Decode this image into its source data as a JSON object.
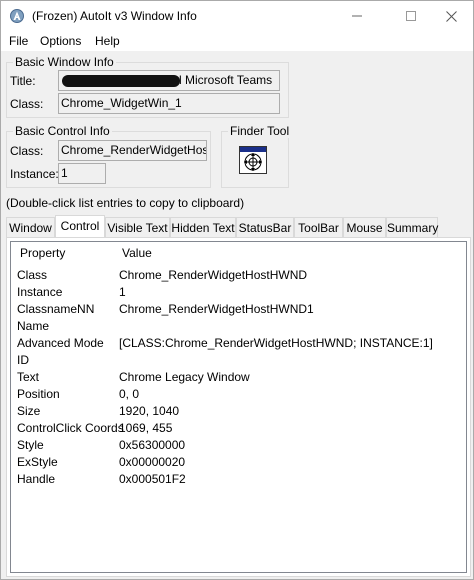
{
  "window": {
    "title": "(Frozen) AutoIt v3 Window Info",
    "minimize_glyph": "—",
    "maximize_glyph": "☐",
    "close_glyph": "✕"
  },
  "menu": {
    "file": "File",
    "options": "Options",
    "help": "Help"
  },
  "basic_window_info": {
    "label": "Basic Window Info",
    "title_label": "Title:",
    "title_value": "l Microsoft Teams",
    "class_label": "Class:",
    "class_value": "Chrome_WidgetWin_1"
  },
  "basic_control_info": {
    "label": "Basic Control Info",
    "class_label": "Class:",
    "class_value": "Chrome_RenderWidgetHostH\\",
    "instance_label": "Instance:",
    "instance_value": "1"
  },
  "finder_tool": {
    "label": "Finder Tool",
    "icon": "crosshair-icon"
  },
  "hint": "(Double-click list entries to copy to clipboard)",
  "tabs": [
    {
      "label": "Window"
    },
    {
      "label": "Control"
    },
    {
      "label": "Visible Text"
    },
    {
      "label": "Hidden Text"
    },
    {
      "label": "StatusBar"
    },
    {
      "label": "ToolBar"
    },
    {
      "label": "Mouse"
    },
    {
      "label": "Summary"
    }
  ],
  "active_tab": "Control",
  "list": {
    "columns": {
      "property": "Property",
      "value": "Value"
    },
    "rows": [
      {
        "property": "Class",
        "value": "Chrome_RenderWidgetHostHWND"
      },
      {
        "property": "Instance",
        "value": "1"
      },
      {
        "property": "ClassnameNN",
        "value": "Chrome_RenderWidgetHostHWND1"
      },
      {
        "property": "Name",
        "value": ""
      },
      {
        "property": "Advanced Mode",
        "value": "[CLASS:Chrome_RenderWidgetHostHWND; INSTANCE:1]"
      },
      {
        "property": "ID",
        "value": ""
      },
      {
        "property": "Text",
        "value": "Chrome Legacy Window"
      },
      {
        "property": "Position",
        "value": "0, 0"
      },
      {
        "property": "Size",
        "value": "1920, 1040"
      },
      {
        "property": "ControlClick Coords",
        "value": "1069, 455"
      },
      {
        "property": "Style",
        "value": "0x56300000"
      },
      {
        "property": "ExStyle",
        "value": "0x00000020"
      },
      {
        "property": "Handle",
        "value": "0x000501F2"
      }
    ]
  }
}
